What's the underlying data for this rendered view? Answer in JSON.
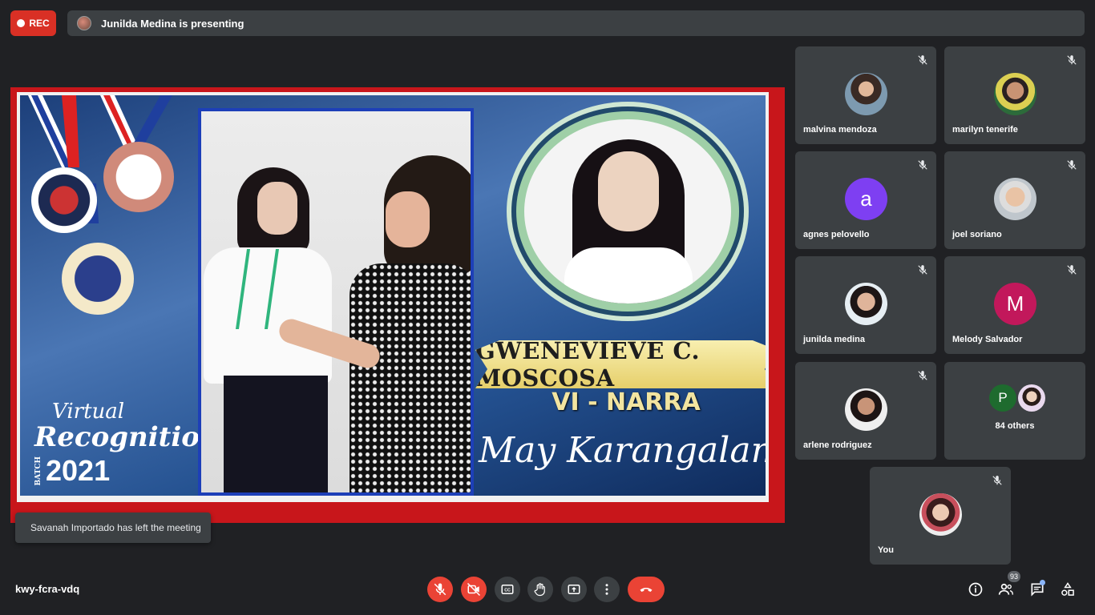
{
  "recording": {
    "label": "REC"
  },
  "presenting_bar": {
    "text": "Junilda Medina is presenting"
  },
  "presentation": {
    "event_line1": "Virtual",
    "event_line2": "Recognition",
    "batch_label": "BATCH",
    "year": "2021",
    "student_name": "GWENEVIEVE C. MOSCOSA",
    "section": "VI - NARRA",
    "honor": "May Karangalan"
  },
  "toast": {
    "text": "Savanah Importado has left the meeting"
  },
  "participants": [
    {
      "name": "malvina mendoza",
      "avatar": "photo",
      "muted": true
    },
    {
      "name": "marilyn tenerife",
      "avatar": "photo",
      "muted": true
    },
    {
      "name": "agnes pelovello",
      "avatar_letter": "a",
      "avatar_color": "#7e3ff2",
      "muted": true
    },
    {
      "name": "joel soriano",
      "avatar": "photo",
      "muted": true
    },
    {
      "name": "junilda medina",
      "avatar": "photo",
      "muted": true
    },
    {
      "name": "Melody Salvador",
      "avatar_letter": "M",
      "avatar_color": "#c2185b",
      "muted": true
    },
    {
      "name": "arlene rodriguez",
      "avatar": "photo",
      "muted": true
    }
  ],
  "others": {
    "letter": "P",
    "label": "84 others"
  },
  "self_tile": {
    "name": "You",
    "muted": true
  },
  "bottom_bar": {
    "meeting_code": "kwy-fcra-vdq",
    "participant_count": "93",
    "controls": [
      "mic-off-icon",
      "camera-off-icon",
      "captions-icon",
      "raise-hand-icon",
      "present-icon",
      "more-options-icon",
      "end-call-icon"
    ],
    "right_icons": [
      "info-icon",
      "people-icon",
      "chat-icon",
      "activities-icon"
    ]
  },
  "colors": {
    "background": "#202124",
    "tile": "#3c4043",
    "danger": "#ea4335",
    "accent": "#8ab4f8"
  }
}
